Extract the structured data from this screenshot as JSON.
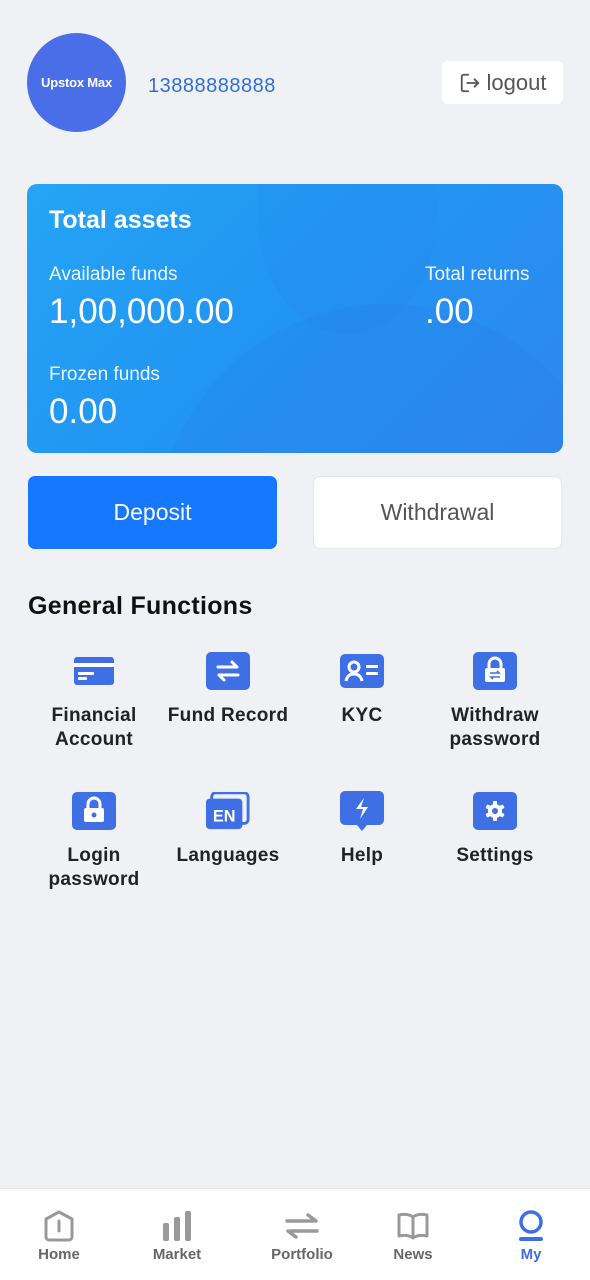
{
  "header": {
    "avatar_text": "Upstox Max",
    "phone": "13888888888",
    "logout_label": "logout"
  },
  "assets": {
    "title": "Total assets",
    "available_label": "Available funds",
    "available_value": "1,00,000.00",
    "returns_label": "Total returns",
    "returns_value": ".00",
    "frozen_label": "Frozen funds",
    "frozen_value": "0.00"
  },
  "actions": {
    "deposit_label": "Deposit",
    "withdrawal_label": "Withdrawal"
  },
  "functions": {
    "title": "General Functions",
    "items": [
      {
        "label": "Financial Account",
        "icon": "card-icon"
      },
      {
        "label": "Fund Record",
        "icon": "transfer-icon"
      },
      {
        "label": "KYC",
        "icon": "id-card-icon"
      },
      {
        "label": "Withdraw password",
        "icon": "lock-exchange-icon"
      },
      {
        "label": "Login password",
        "icon": "lock-icon"
      },
      {
        "label": "Languages",
        "icon": "language-en-icon"
      },
      {
        "label": "Help",
        "icon": "lightning-chat-icon"
      },
      {
        "label": "Settings",
        "icon": "gear-icon"
      }
    ]
  },
  "tabbar": {
    "items": [
      {
        "label": "Home",
        "icon": "home-icon"
      },
      {
        "label": "Market",
        "icon": "bar-chart-icon"
      },
      {
        "label": "Portfolio",
        "icon": "swap-icon"
      },
      {
        "label": "News",
        "icon": "book-icon"
      },
      {
        "label": "My",
        "icon": "user-icon"
      }
    ],
    "active": "My"
  },
  "colors": {
    "accent": "#1677ff",
    "icon_blue": "#3f6fe4",
    "card_gradient_start": "#25a4f4",
    "card_gradient_end": "#2f86ee",
    "phone_link": "#2f6fd6",
    "background": "#f0f1f5"
  }
}
